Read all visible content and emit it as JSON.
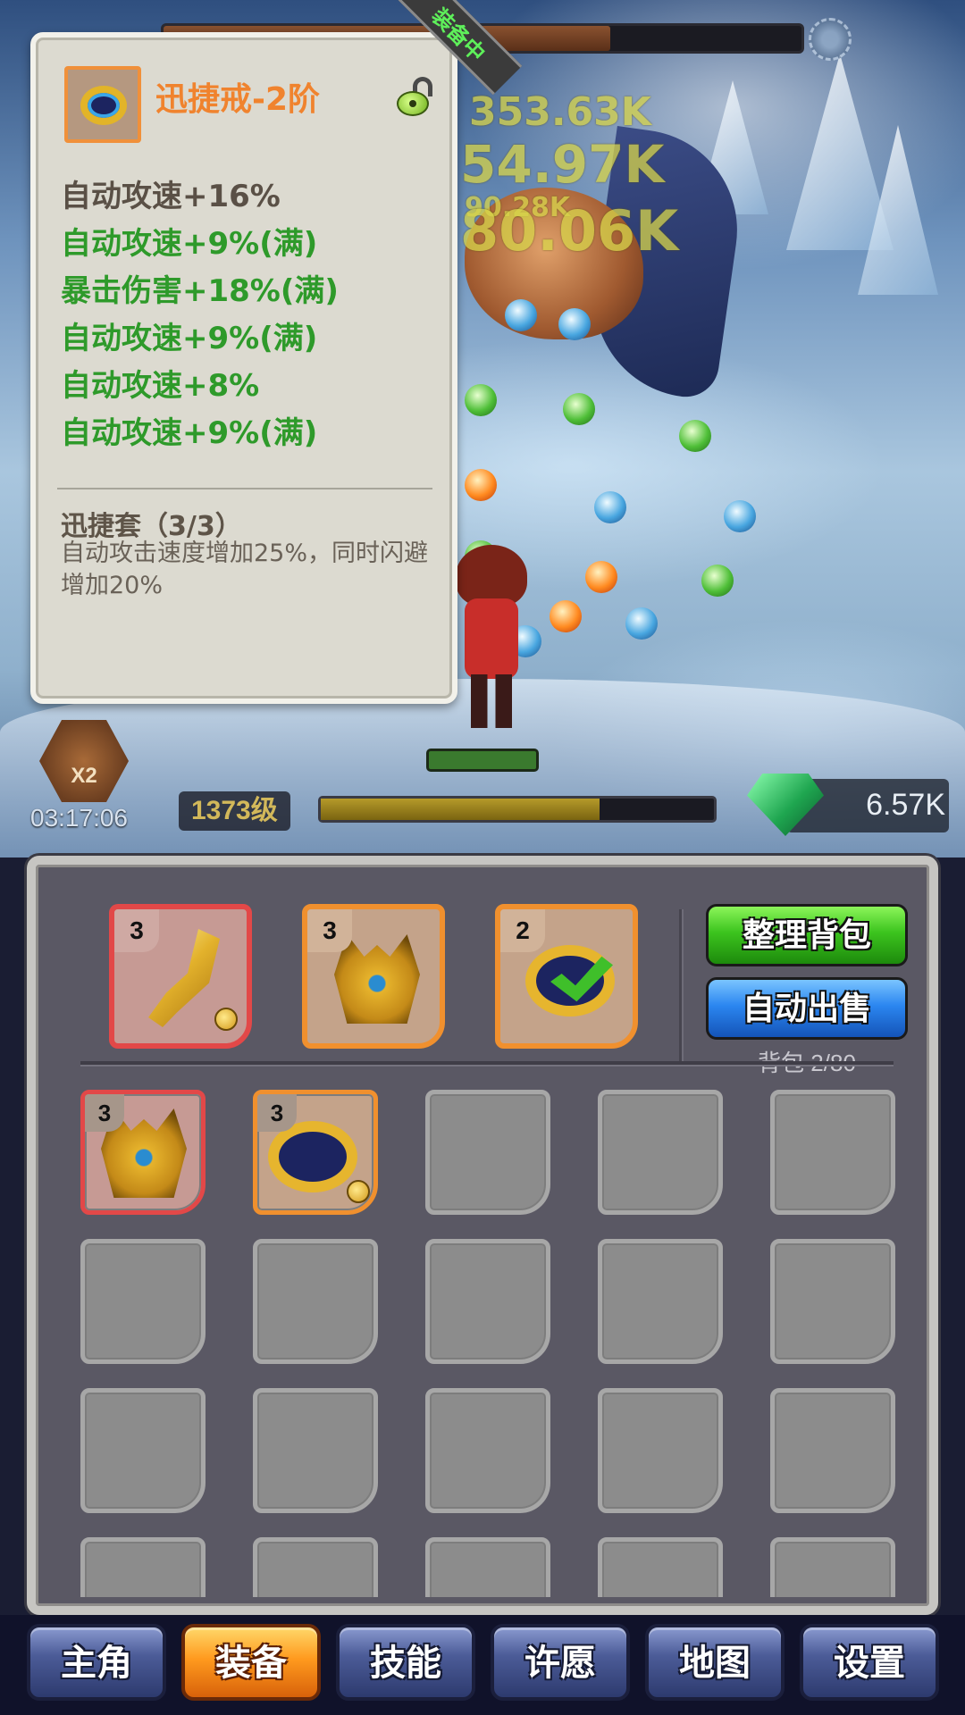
{
  "battle": {
    "boss_hp_fraction": 0.7,
    "damage_numbers": [
      "353.63K",
      "54.97K",
      "90.28K",
      "80.06K"
    ],
    "potion_multiplier": "X2",
    "timer": "03:17:06",
    "level": "1373级",
    "xp_fraction": 0.71,
    "gems": "6.57K"
  },
  "tooltip": {
    "badge": "装备中",
    "item_name": "迅捷戒-2阶",
    "stats": [
      {
        "text": "自动攻速+16%",
        "color": "white"
      },
      {
        "text": "自动攻速+9%(满)",
        "color": "green"
      },
      {
        "text": "暴击伤害+18%(满)",
        "color": "green"
      },
      {
        "text": "自动攻速+9%(满)",
        "color": "green"
      },
      {
        "text": "自动攻速+8%",
        "color": "green"
      },
      {
        "text": "自动攻速+9%(满)",
        "color": "green"
      }
    ],
    "set_name": "迅捷套（3/3）",
    "set_description": "自动攻击速度增加25%，同时闪避增加20%"
  },
  "equipped": [
    {
      "count": "3",
      "item": "sword",
      "rarity": "red",
      "locked": true
    },
    {
      "count": "3",
      "item": "helmet",
      "rarity": "orange",
      "locked": false
    },
    {
      "count": "2",
      "item": "ring",
      "rarity": "orange",
      "equipped_check": true
    }
  ],
  "buttons": {
    "sort": "整理背包",
    "auto_sell": "自动出售"
  },
  "bag_count": "背包 2/80",
  "bag_items": [
    {
      "count": "3",
      "item": "helmet",
      "rarity": "red",
      "locked": false
    },
    {
      "count": "3",
      "item": "ring",
      "rarity": "orange",
      "locked": true
    }
  ],
  "tabs": [
    {
      "label": "主角",
      "active": false
    },
    {
      "label": "装备",
      "active": true
    },
    {
      "label": "技能",
      "active": false
    },
    {
      "label": "许愿",
      "active": false
    },
    {
      "label": "地图",
      "active": false
    },
    {
      "label": "设置",
      "active": false
    }
  ],
  "colors": {
    "rarity_red": "#e24848",
    "rarity_orange": "#f0902e",
    "stat_green": "#2e9a2a",
    "active_tab": "#ff9a1e"
  }
}
